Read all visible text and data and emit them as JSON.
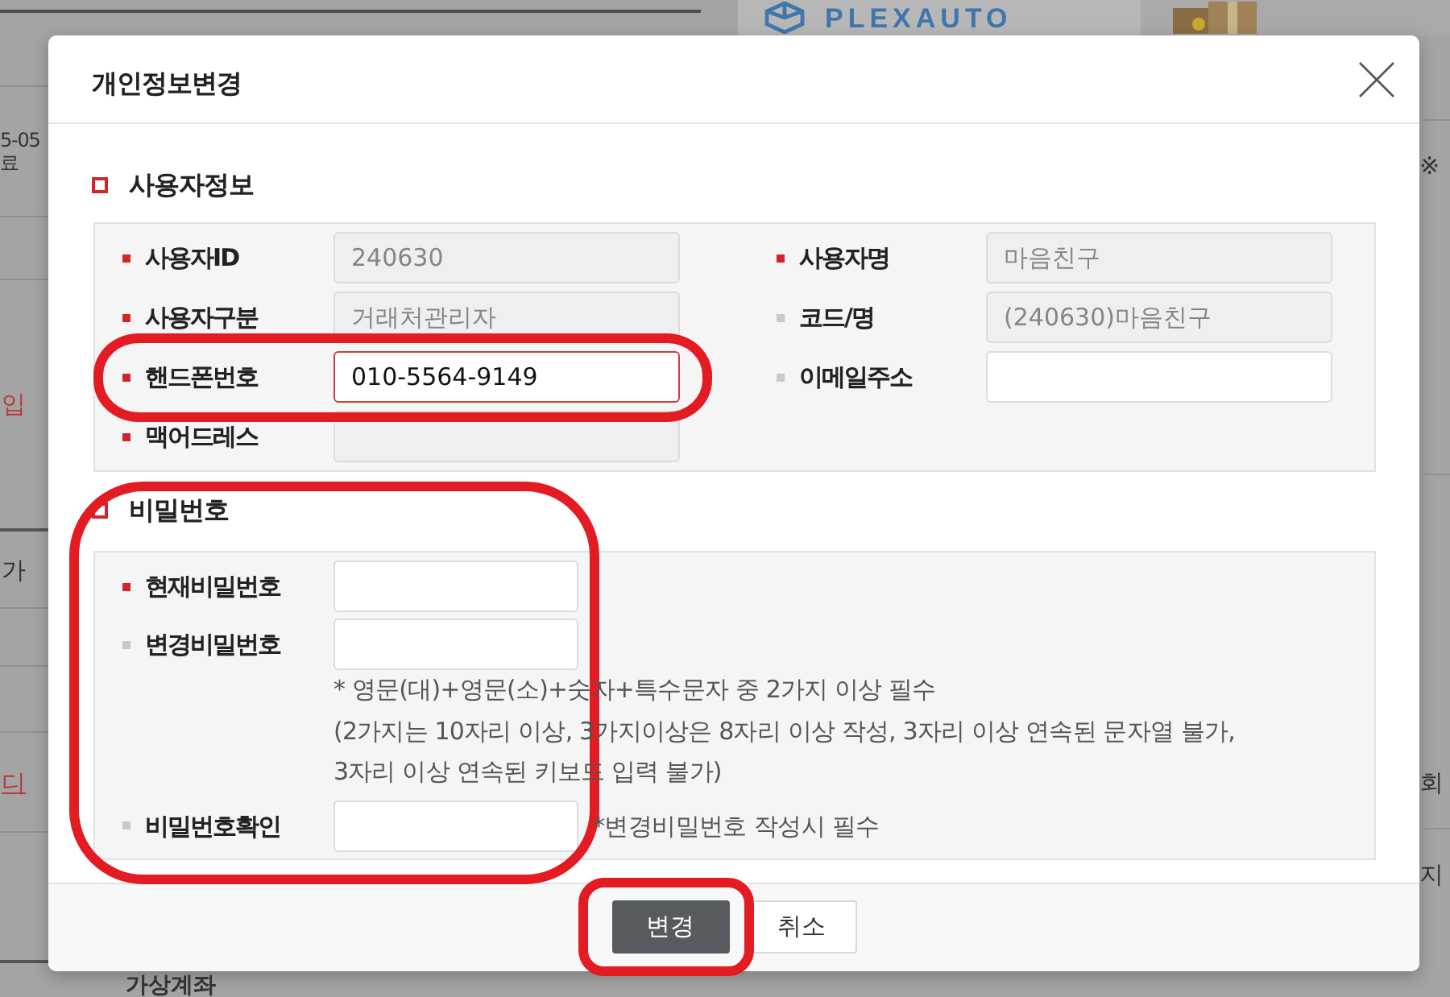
{
  "background": {
    "logo": "PLEXAUTO",
    "left_texts": [
      {
        "text": "5-05",
        "color": "#333333",
        "underlined": false
      },
      {
        "text": "료",
        "color": "#333333",
        "underlined": false
      },
      {
        "text": "입",
        "color": "#b83b3b",
        "underlined": false
      },
      {
        "text": "가",
        "color": "#333333",
        "underlined": false
      },
      {
        "text": "디",
        "color": "#b83b3b",
        "underlined": true
      }
    ],
    "right_texts": [
      "※",
      "회",
      "지"
    ],
    "bottom_text": "가상계좌"
  },
  "dialog": {
    "title": "개인정보변경",
    "sections": [
      {
        "title": "사용자정보",
        "kind": "pair",
        "circled": false,
        "rows": [
          [
            {
              "label": "사용자ID",
              "required": true,
              "disabled": true,
              "focused": false,
              "circled": false,
              "value": "240630"
            },
            {
              "label": "사용자명",
              "required": true,
              "disabled": true,
              "focused": false,
              "circled": false,
              "value": "마음친구"
            }
          ],
          [
            {
              "label": "사용자구분",
              "required": true,
              "disabled": true,
              "focused": false,
              "circled": false,
              "value": "거래처관리자"
            },
            {
              "label": "코드/명",
              "required": false,
              "disabled": true,
              "focused": false,
              "circled": false,
              "value": "(240630)마음친구"
            }
          ],
          [
            {
              "label": "핸드폰번호",
              "required": true,
              "disabled": false,
              "focused": true,
              "circled": true,
              "value": "010-5564-9149"
            },
            {
              "label": "이메일주소",
              "required": false,
              "disabled": false,
              "focused": false,
              "circled": false
            }
          ],
          [
            {
              "label": "맥어드레스",
              "required": true,
              "disabled": true,
              "focused": false,
              "circled": false
            }
          ]
        ]
      },
      {
        "title": "비밀번호",
        "kind": "single",
        "circled": true,
        "rows": [
          [
            {
              "label": "현재비밀번호",
              "required": true,
              "disabled": false,
              "focused": false,
              "circled": false
            }
          ],
          [
            {
              "label": "변경비밀번호",
              "required": false,
              "disabled": false,
              "focused": false,
              "circled": false,
              "hint": [
                "* 영문(대)+영문(소)+숫자+특수문자 중 2가지 이상 필수",
                "(2가지는 10자리 이상, 3가지이상은 8자리 이상 작성, 3자리 이상 연속된 문자열 불가,",
                "3자리 이상 연속된 키보드 입력 불가)"
              ]
            }
          ],
          [
            {
              "label": "비밀번호확인",
              "required": false,
              "disabled": false,
              "focused": false,
              "circled": false,
              "note": "*변경비밀번호 작성시 필수"
            }
          ]
        ]
      }
    ],
    "buttons": [
      {
        "label": "변경",
        "kind": "primary",
        "circled": true
      },
      {
        "label": "취소",
        "kind": "secondary",
        "circled": false
      }
    ]
  }
}
